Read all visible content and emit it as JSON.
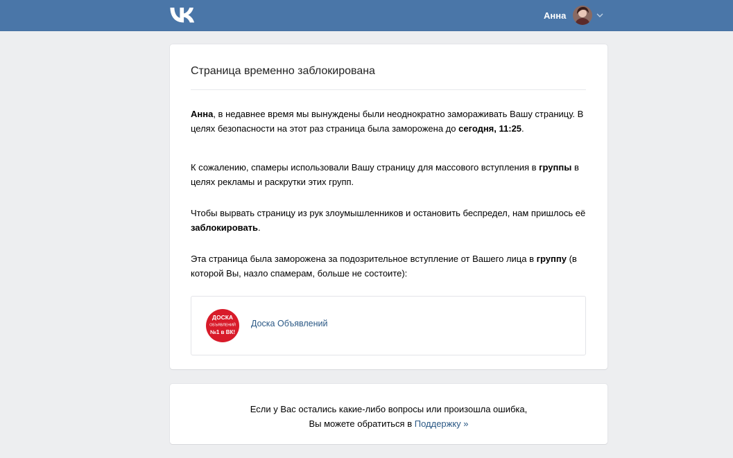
{
  "header": {
    "user_name": "Анна",
    "brand_color": "#4a76a8"
  },
  "main": {
    "title": "Страница временно заблокирована",
    "p1": {
      "name": "Анна",
      "text_a": ", в недавнее время мы вынуждены были неоднократно замораживать Вашу страницу. В целях безопасности на этот раз страница была заморожена до ",
      "until": "сегодня, 11:25",
      "text_b": "."
    },
    "p2": {
      "text_a": "К сожалению, спамеры использовали Вашу страницу для массового вступления в ",
      "bold": "группы",
      "text_b": " в целях рекламы и раскрутки этих групп."
    },
    "p3": {
      "text_a": "Чтобы вырвать страницу из рук злоумышленников и остановить беспредел, нам пришлось её ",
      "bold": "заблокировать",
      "text_b": "."
    },
    "p4": {
      "text_a": "Эта страница была заморожена за подозрительное вступление от Вашего лица в ",
      "bold": "группу",
      "text_b": " (в которой Вы, назло спамерам, больше не состоите):"
    },
    "group": {
      "name": "Доска Объявлений",
      "logo_lines": [
        "ДОСКА",
        "ОБЪЯВЛЕНИЙ",
        "№1 в ВК!"
      ]
    }
  },
  "help": {
    "line1": "Если у Вас остались какие-либо вопросы или произошла ошибка,",
    "line2": "Вы можете обратиться в ",
    "support_link": "Поддержку »"
  }
}
